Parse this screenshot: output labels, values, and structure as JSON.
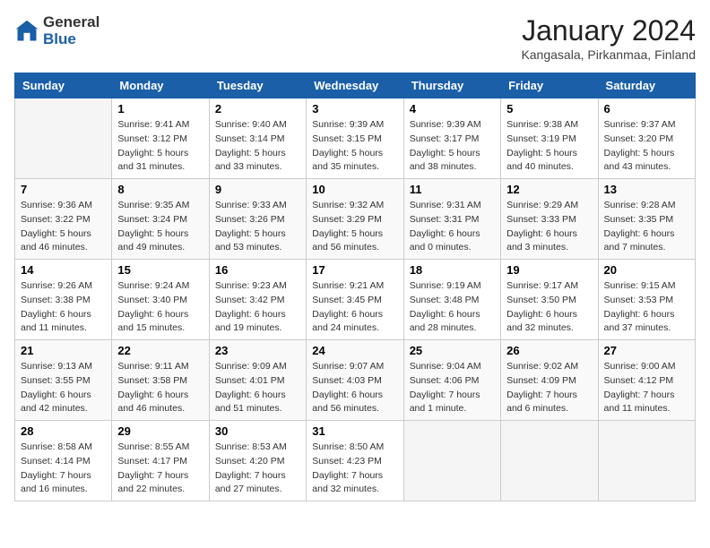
{
  "header": {
    "logo_general": "General",
    "logo_blue": "Blue",
    "title": "January 2024",
    "subtitle": "Kangasala, Pirkanmaa, Finland"
  },
  "days_of_week": [
    "Sunday",
    "Monday",
    "Tuesday",
    "Wednesday",
    "Thursday",
    "Friday",
    "Saturday"
  ],
  "weeks": [
    [
      {
        "day": "",
        "info": ""
      },
      {
        "day": "1",
        "info": "Sunrise: 9:41 AM\nSunset: 3:12 PM\nDaylight: 5 hours\nand 31 minutes."
      },
      {
        "day": "2",
        "info": "Sunrise: 9:40 AM\nSunset: 3:14 PM\nDaylight: 5 hours\nand 33 minutes."
      },
      {
        "day": "3",
        "info": "Sunrise: 9:39 AM\nSunset: 3:15 PM\nDaylight: 5 hours\nand 35 minutes."
      },
      {
        "day": "4",
        "info": "Sunrise: 9:39 AM\nSunset: 3:17 PM\nDaylight: 5 hours\nand 38 minutes."
      },
      {
        "day": "5",
        "info": "Sunrise: 9:38 AM\nSunset: 3:19 PM\nDaylight: 5 hours\nand 40 minutes."
      },
      {
        "day": "6",
        "info": "Sunrise: 9:37 AM\nSunset: 3:20 PM\nDaylight: 5 hours\nand 43 minutes."
      }
    ],
    [
      {
        "day": "7",
        "info": "Sunrise: 9:36 AM\nSunset: 3:22 PM\nDaylight: 5 hours\nand 46 minutes."
      },
      {
        "day": "8",
        "info": "Sunrise: 9:35 AM\nSunset: 3:24 PM\nDaylight: 5 hours\nand 49 minutes."
      },
      {
        "day": "9",
        "info": "Sunrise: 9:33 AM\nSunset: 3:26 PM\nDaylight: 5 hours\nand 53 minutes."
      },
      {
        "day": "10",
        "info": "Sunrise: 9:32 AM\nSunset: 3:29 PM\nDaylight: 5 hours\nand 56 minutes."
      },
      {
        "day": "11",
        "info": "Sunrise: 9:31 AM\nSunset: 3:31 PM\nDaylight: 6 hours\nand 0 minutes."
      },
      {
        "day": "12",
        "info": "Sunrise: 9:29 AM\nSunset: 3:33 PM\nDaylight: 6 hours\nand 3 minutes."
      },
      {
        "day": "13",
        "info": "Sunrise: 9:28 AM\nSunset: 3:35 PM\nDaylight: 6 hours\nand 7 minutes."
      }
    ],
    [
      {
        "day": "14",
        "info": "Sunrise: 9:26 AM\nSunset: 3:38 PM\nDaylight: 6 hours\nand 11 minutes."
      },
      {
        "day": "15",
        "info": "Sunrise: 9:24 AM\nSunset: 3:40 PM\nDaylight: 6 hours\nand 15 minutes."
      },
      {
        "day": "16",
        "info": "Sunrise: 9:23 AM\nSunset: 3:42 PM\nDaylight: 6 hours\nand 19 minutes."
      },
      {
        "day": "17",
        "info": "Sunrise: 9:21 AM\nSunset: 3:45 PM\nDaylight: 6 hours\nand 24 minutes."
      },
      {
        "day": "18",
        "info": "Sunrise: 9:19 AM\nSunset: 3:48 PM\nDaylight: 6 hours\nand 28 minutes."
      },
      {
        "day": "19",
        "info": "Sunrise: 9:17 AM\nSunset: 3:50 PM\nDaylight: 6 hours\nand 32 minutes."
      },
      {
        "day": "20",
        "info": "Sunrise: 9:15 AM\nSunset: 3:53 PM\nDaylight: 6 hours\nand 37 minutes."
      }
    ],
    [
      {
        "day": "21",
        "info": "Sunrise: 9:13 AM\nSunset: 3:55 PM\nDaylight: 6 hours\nand 42 minutes."
      },
      {
        "day": "22",
        "info": "Sunrise: 9:11 AM\nSunset: 3:58 PM\nDaylight: 6 hours\nand 46 minutes."
      },
      {
        "day": "23",
        "info": "Sunrise: 9:09 AM\nSunset: 4:01 PM\nDaylight: 6 hours\nand 51 minutes."
      },
      {
        "day": "24",
        "info": "Sunrise: 9:07 AM\nSunset: 4:03 PM\nDaylight: 6 hours\nand 56 minutes."
      },
      {
        "day": "25",
        "info": "Sunrise: 9:04 AM\nSunset: 4:06 PM\nDaylight: 7 hours\nand 1 minute."
      },
      {
        "day": "26",
        "info": "Sunrise: 9:02 AM\nSunset: 4:09 PM\nDaylight: 7 hours\nand 6 minutes."
      },
      {
        "day": "27",
        "info": "Sunrise: 9:00 AM\nSunset: 4:12 PM\nDaylight: 7 hours\nand 11 minutes."
      }
    ],
    [
      {
        "day": "28",
        "info": "Sunrise: 8:58 AM\nSunset: 4:14 PM\nDaylight: 7 hours\nand 16 minutes."
      },
      {
        "day": "29",
        "info": "Sunrise: 8:55 AM\nSunset: 4:17 PM\nDaylight: 7 hours\nand 22 minutes."
      },
      {
        "day": "30",
        "info": "Sunrise: 8:53 AM\nSunset: 4:20 PM\nDaylight: 7 hours\nand 27 minutes."
      },
      {
        "day": "31",
        "info": "Sunrise: 8:50 AM\nSunset: 4:23 PM\nDaylight: 7 hours\nand 32 minutes."
      },
      {
        "day": "",
        "info": ""
      },
      {
        "day": "",
        "info": ""
      },
      {
        "day": "",
        "info": ""
      }
    ]
  ]
}
